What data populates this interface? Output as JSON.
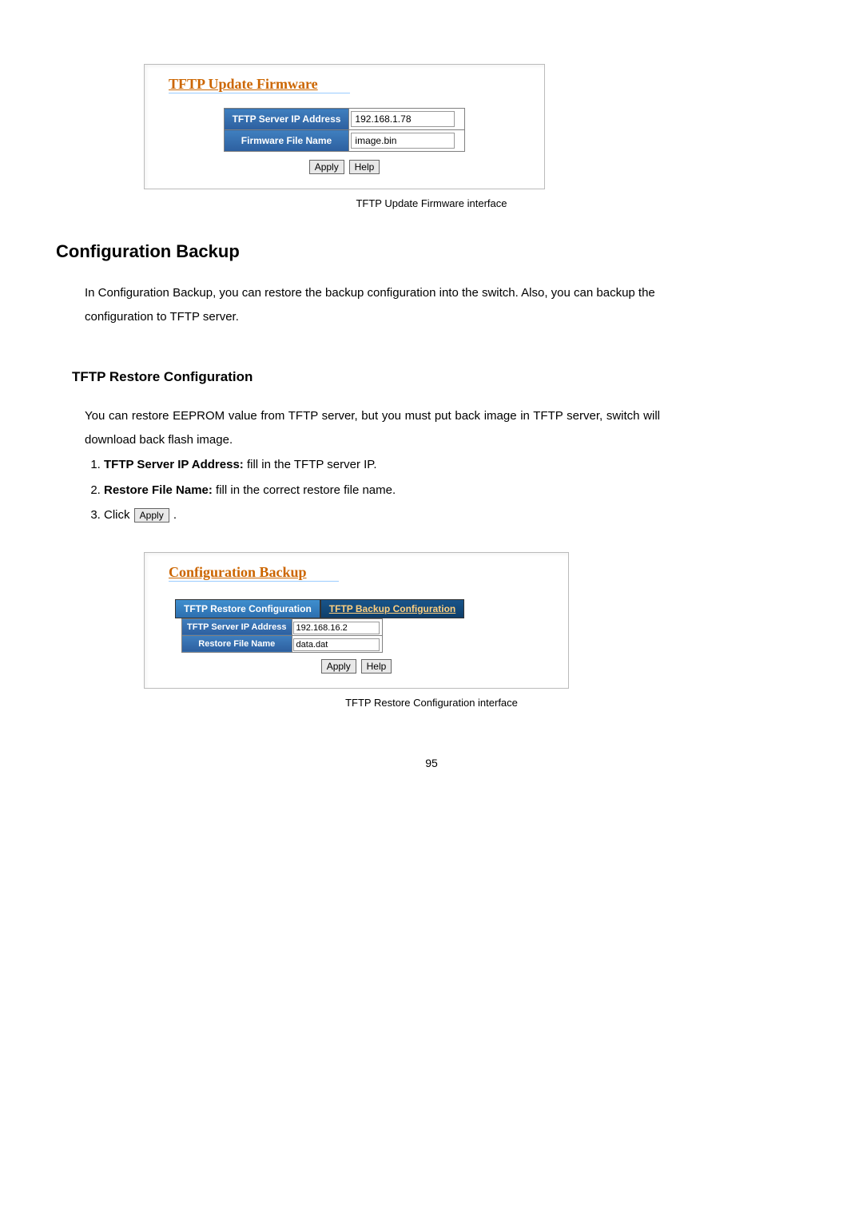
{
  "firmware_panel": {
    "title": "TFTP Update Firmware",
    "field1_label": "TFTP Server IP Address",
    "field1_value": "192.168.1.78",
    "field2_label": "Firmware File Name",
    "field2_value": "image.bin",
    "apply": "Apply",
    "help": "Help",
    "caption": "TFTP Update Firmware interface"
  },
  "section_heading": "Configuration Backup",
  "section_para": "In Configuration Backup, you can restore the backup configuration into the switch. Also, you can backup the configuration to TFTP server.",
  "subsection_heading": "TFTP Restore Configuration",
  "subsection_para": "You can restore EEPROM value from TFTP server, but you must put back image in TFTP server, switch will download back flash image.",
  "steps": {
    "s1_bold": "TFTP Server IP Address:",
    "s1_rest": " fill in the TFTP server IP.",
    "s2_bold": "Restore File Name:",
    "s2_rest": " fill in the correct restore file name.",
    "s3_prefix": "Click ",
    "s3_btn": "Apply",
    "s3_suffix": " ."
  },
  "backup_panel": {
    "title": "Configuration Backup",
    "tab1": "TFTP Restore Configuration",
    "tab2": "TFTP Backup Configuration",
    "field1_label": "TFTP Server IP Address",
    "field1_value": "192.168.16.2",
    "field2_label": "Restore File Name",
    "field2_value": "data.dat",
    "apply": "Apply",
    "help": "Help",
    "caption": "TFTP Restore Configuration interface"
  },
  "page_number": "95"
}
